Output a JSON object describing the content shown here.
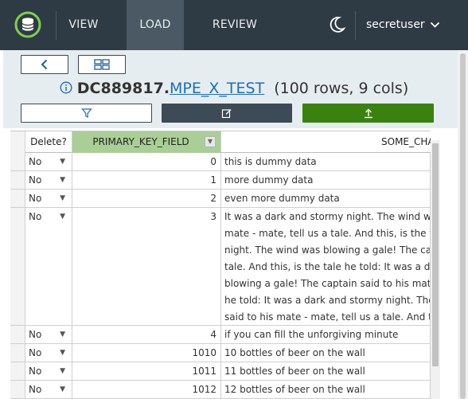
{
  "nav": {
    "items": [
      {
        "label": "VIEW"
      },
      {
        "label": "LOAD"
      },
      {
        "label": "REVIEW"
      }
    ],
    "active": "LOAD",
    "user": "secretuser"
  },
  "toolbar": {
    "library": "DC889817",
    "dataset": "MPE_X_TEST",
    "summary": "(100 rows, 9 cols)"
  },
  "table": {
    "headers": [
      "Delete?",
      "PRIMARY_KEY_FIELD",
      "SOME_CHA"
    ],
    "rows": [
      {
        "del": "No",
        "pk": "0",
        "some": [
          "this is dummy data"
        ]
      },
      {
        "del": "No",
        "pk": "1",
        "some": [
          "more dummy data"
        ]
      },
      {
        "del": "No",
        "pk": "2",
        "some": [
          "even more dummy data"
        ]
      },
      {
        "del": "No",
        "pk": "3",
        "some": [
          "It was a dark and stormy night.  The wind was",
          "mate - mate, tell us a tale.  And this, is the tal",
          "night.  The wind was blowing a gale!  The capt",
          "tale.  And this, is the tale he told: It was a dar",
          "blowing a gale!  The captain said to his mate -",
          "he told: It was a dark and stormy night.  The v",
          "said to his mate - mate, tell us a tale.  And thi"
        ]
      },
      {
        "del": "No",
        "pk": "4",
        "some": [
          "if you can fill the unforgiving minute"
        ]
      },
      {
        "del": "No",
        "pk": "1010",
        "some": [
          "10 bottles of beer on the wall"
        ]
      },
      {
        "del": "No",
        "pk": "1011",
        "some": [
          "11 bottles of beer on the wall"
        ]
      },
      {
        "del": "No",
        "pk": "1012",
        "some": [
          "12 bottles of beer on the wall"
        ]
      }
    ]
  }
}
